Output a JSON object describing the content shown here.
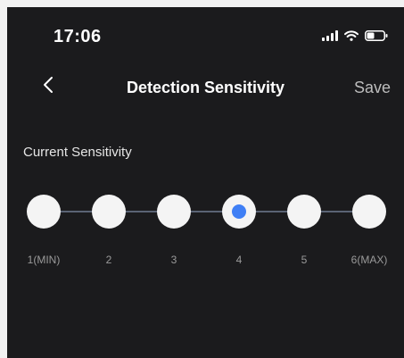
{
  "status_bar": {
    "time": "17:06",
    "icons": [
      "signal-icon",
      "wifi-icon",
      "battery-icon"
    ]
  },
  "nav": {
    "back_icon": "chevron-left-icon",
    "title": "Detection Sensitivity",
    "save_label": "Save"
  },
  "sensitivity": {
    "section_label": "Current Sensitivity",
    "selected_level": 4,
    "levels": [
      {
        "label": "1(MIN)"
      },
      {
        "label": "2"
      },
      {
        "label": "3"
      },
      {
        "label": "4"
      },
      {
        "label": "5"
      },
      {
        "label": "6(MAX)"
      }
    ]
  },
  "colors": {
    "background": "#1b1b1d",
    "accent": "#3f7ff5",
    "step_fill": "#f4f4f4",
    "track": "#5a6374",
    "save_text": "#bdbdbd"
  }
}
